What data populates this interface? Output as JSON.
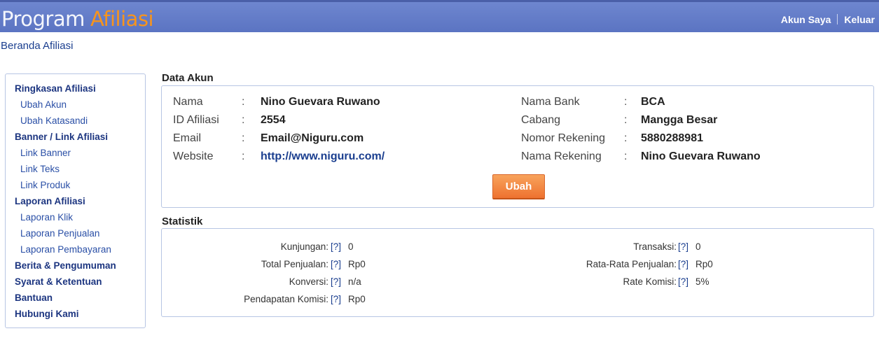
{
  "header": {
    "brand_part1": "Program",
    "brand_part2": "Afiliasi",
    "links": {
      "account": "Akun Saya",
      "logout": "Keluar"
    },
    "accent_color": "#5b74c2",
    "brand_accent_color": "#f7941d"
  },
  "breadcrumb": "Beranda Afiliasi",
  "sidebar": {
    "items": [
      {
        "label": "Ringkasan Afiliasi",
        "level": "head"
      },
      {
        "label": "Ubah Akun",
        "level": "sub"
      },
      {
        "label": "Ubah Katasandi",
        "level": "sub"
      },
      {
        "label": "Banner / Link Afiliasi",
        "level": "head"
      },
      {
        "label": "Link Banner",
        "level": "sub"
      },
      {
        "label": "Link Teks",
        "level": "sub"
      },
      {
        "label": "Link Produk",
        "level": "sub"
      },
      {
        "label": "Laporan Afiliasi",
        "level": "head"
      },
      {
        "label": "Laporan Klik",
        "level": "sub"
      },
      {
        "label": "Laporan Penjualan",
        "level": "sub"
      },
      {
        "label": "Laporan Pembayaran",
        "level": "sub"
      },
      {
        "label": "Berita & Pengumuman",
        "level": "head"
      },
      {
        "label": "Syarat & Ketentuan",
        "level": "head"
      },
      {
        "label": "Bantuan",
        "level": "head"
      },
      {
        "label": "Hubungi Kami",
        "level": "head"
      }
    ]
  },
  "account": {
    "title": "Data Akun",
    "colon": ":",
    "left": [
      {
        "label": "Nama",
        "value": "Nino Guevara Ruwano"
      },
      {
        "label": "ID Afiliasi",
        "value": "2554"
      },
      {
        "label": "Email",
        "value": "Email@Niguru.com"
      },
      {
        "label": "Website",
        "value": "http://www.niguru.com/"
      }
    ],
    "right": [
      {
        "label": "Nama Bank",
        "value": "BCA"
      },
      {
        "label": "Cabang",
        "value": "Mangga Besar"
      },
      {
        "label": "Nomor Rekening",
        "value": "5880288981"
      },
      {
        "label": "Nama Rekening",
        "value": "Nino Guevara Ruwano"
      }
    ],
    "edit_button": "Ubah"
  },
  "stats": {
    "title": "Statistik",
    "help": "[?]",
    "left": [
      {
        "label": "Kunjungan:",
        "value": "0"
      },
      {
        "label": "Total Penjualan:",
        "value": "Rp0"
      },
      {
        "label": "Konversi:",
        "value": "n/a"
      },
      {
        "label": "Pendapatan Komisi:",
        "value": "Rp0"
      }
    ],
    "right": [
      {
        "label": "Transaksi:",
        "value": "0"
      },
      {
        "label": "Rata-Rata Penjualan:",
        "value": "Rp0"
      },
      {
        "label": "Rate Komisi:",
        "value": "5%"
      }
    ]
  }
}
